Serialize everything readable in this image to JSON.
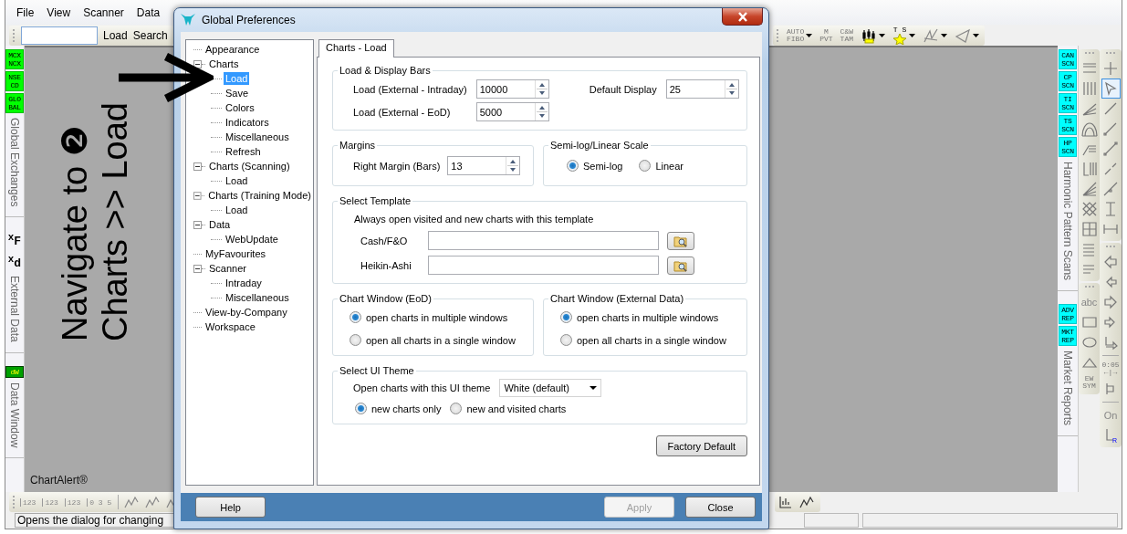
{
  "menu": [
    "File",
    "View",
    "Scanner",
    "Data"
  ],
  "quick_toolbar": {
    "buttons": [
      "Load",
      "Search"
    ]
  },
  "chart_toolbar": [
    {
      "kind": "text",
      "lines": [
        "AUTO",
        "FIBO"
      ],
      "dropdown": true
    },
    {
      "kind": "text",
      "lines": [
        "M",
        "PVT"
      ],
      "dropdown": false
    },
    {
      "kind": "text",
      "lines": [
        "C&W",
        "TAM"
      ],
      "dropdown": false
    },
    {
      "kind": "icon",
      "dropdown": true
    },
    {
      "kind": "star",
      "lines": [
        "T S"
      ],
      "dropdown": true
    },
    {
      "kind": "icon",
      "dropdown": true
    },
    {
      "kind": "icon",
      "dropdown": true
    }
  ],
  "left_tabs": [
    {
      "title": "Global Exchanges",
      "badges": [
        {
          "kind": "exchange",
          "text": "MCX NCX"
        },
        {
          "kind": "exchange",
          "text": "NSE CD"
        },
        {
          "kind": "exchange",
          "text": "GLO BAL"
        }
      ]
    },
    {
      "title": "External Data",
      "badges": [
        {
          "kind": "formula",
          "text": "$^{x}$F"
        },
        {
          "kind": "formula",
          "text": "$^{x}$d"
        }
      ]
    },
    {
      "title": "Data Window",
      "badges": [
        {
          "kind": "data",
          "text": "dW"
        }
      ]
    }
  ],
  "canvas_label": "ChartAlert®",
  "annotation": {
    "lines": [
      "Navigate to ❷",
      "Charts >> Load"
    ]
  },
  "scan_tabs": [
    {
      "title": "Harmonic Pattern Scans",
      "badges": [
        "CAN SCN",
        "CP SCN",
        "TI SCN",
        "TS SCN",
        "HP SCN"
      ]
    },
    {
      "title": "Market Reports",
      "badges": [
        "ADV REP",
        "MKT REP"
      ]
    }
  ],
  "drawing_tools": {
    "column_1": [
      {
        "kind": "grip"
      },
      {
        "kind": "icon",
        "selected": false
      },
      {
        "kind": "icon",
        "selected": false
      },
      {
        "kind": "icon",
        "selected": false
      },
      {
        "kind": "icon",
        "selected": false
      },
      {
        "kind": "icon",
        "selected": false
      },
      {
        "kind": "icon",
        "selected": false
      },
      {
        "kind": "icon",
        "selected": false
      },
      {
        "kind": "icon",
        "selected": false
      },
      {
        "kind": "icon",
        "selected": false
      },
      {
        "kind": "icon",
        "selected": false
      },
      {
        "kind": "icon",
        "selected": false
      },
      {
        "kind": "grip"
      },
      {
        "kind": "text",
        "lines": [
          "abc"
        ],
        "selected": false
      },
      {
        "kind": "icon",
        "selected": false
      },
      {
        "kind": "icon",
        "selected": false
      },
      {
        "kind": "icon",
        "selected": false
      },
      {
        "kind": "text",
        "lines": [
          "EW",
          "SYM"
        ],
        "selected": false
      }
    ],
    "column_2": [
      {
        "kind": "grip"
      },
      {
        "kind": "icon",
        "selected": false
      },
      {
        "kind": "icon",
        "selected": true
      },
      {
        "kind": "icon",
        "selected": false
      },
      {
        "kind": "icon",
        "selected": false
      },
      {
        "kind": "icon",
        "selected": false
      },
      {
        "kind": "icon",
        "selected": false
      },
      {
        "kind": "icon",
        "selected": false
      },
      {
        "kind": "icon",
        "selected": false
      },
      {
        "kind": "icon",
        "selected": false
      },
      {
        "kind": "grip"
      },
      {
        "kind": "icon",
        "selected": false
      },
      {
        "kind": "icon",
        "selected": false
      },
      {
        "kind": "icon",
        "selected": false
      },
      {
        "kind": "icon",
        "selected": false
      },
      {
        "kind": "icon",
        "selected": false
      },
      {
        "kind": "separator"
      },
      {
        "kind": "text",
        "lines": [
          "0:05",
          "←|→"
        ],
        "selected": false
      },
      {
        "kind": "icon",
        "selected": false
      },
      {
        "kind": "separator"
      },
      {
        "kind": "text",
        "lines": [
          "On"
        ],
        "selected": false
      },
      {
        "kind": "icon",
        "text": "R",
        "selected": false
      }
    ]
  },
  "bottom_toolbar": [
    {
      "kind": "text",
      "text": "123"
    },
    {
      "kind": "text",
      "text": "123"
    },
    {
      "kind": "text",
      "text": "123"
    },
    {
      "kind": "text",
      "text": "0 3 5"
    },
    {
      "kind": "separator"
    },
    {
      "kind": "icon"
    },
    {
      "kind": "icon"
    },
    {
      "kind": "icon"
    }
  ],
  "status_bar": {
    "text": "Opens the dialog for changing"
  },
  "dialog": {
    "title": "Global Preferences",
    "tree": [
      {
        "label": "Appearance",
        "selected": false
      },
      {
        "label": "Charts",
        "selected": false,
        "expanded": true,
        "children": [
          {
            "label": "Load",
            "selected": true
          },
          {
            "label": "Save",
            "selected": false
          },
          {
            "label": "Colors",
            "selected": false
          },
          {
            "label": "Indicators",
            "selected": false
          },
          {
            "label": "Miscellaneous",
            "selected": false
          },
          {
            "label": "Refresh",
            "selected": false
          }
        ]
      },
      {
        "label": "Charts (Scanning)",
        "selected": false,
        "expanded": true,
        "children": [
          {
            "label": "Load",
            "selected": false
          }
        ]
      },
      {
        "label": "Charts (Training Mode)",
        "selected": false,
        "expanded": true,
        "children": [
          {
            "label": "Load",
            "selected": false
          }
        ]
      },
      {
        "label": "Data",
        "selected": false,
        "expanded": true,
        "children": [
          {
            "label": "WebUpdate",
            "selected": false
          }
        ]
      },
      {
        "label": "MyFavourites",
        "selected": false
      },
      {
        "label": "Scanner",
        "selected": false,
        "expanded": true,
        "children": [
          {
            "label": "Intraday",
            "selected": false
          },
          {
            "label": "Miscellaneous",
            "selected": false
          }
        ]
      },
      {
        "label": "View-by-Company",
        "selected": false
      },
      {
        "label": "Workspace",
        "selected": false
      }
    ],
    "tabs": [
      {
        "label": "Charts - Load",
        "selected": true
      }
    ],
    "load_display_bars": {
      "title": "Load & Display Bars",
      "fields": [
        {
          "label": "Load (External - Intraday)",
          "value": "10000"
        },
        {
          "label": "Load (External - EoD)",
          "value": "5000"
        },
        {
          "label": "Default Display",
          "value": "25"
        }
      ]
    },
    "margins": {
      "title": "Margins",
      "field": {
        "label": "Right Margin (Bars)",
        "value": "13"
      }
    },
    "scale": {
      "title": "Semi-log/Linear Scale",
      "options": [
        {
          "label": "Semi-log",
          "selected": true
        },
        {
          "label": "Linear",
          "selected": false
        }
      ]
    },
    "template": {
      "title": "Select Template",
      "note": "Always open visited and new charts with this template",
      "fields": [
        {
          "label": "Cash/F&O"
        },
        {
          "label": "Heikin-Ashi"
        }
      ]
    },
    "chart_windows": [
      {
        "title": "Chart Window (EoD)",
        "options": [
          {
            "label": "open charts in multiple windows",
            "selected": true
          },
          {
            "label": "open all charts in a single window",
            "selected": false
          }
        ]
      },
      {
        "title": "Chart Window (External Data)",
        "options": [
          {
            "label": "open charts in multiple windows",
            "selected": true
          },
          {
            "label": "open all charts in a single window",
            "selected": false
          }
        ]
      }
    ],
    "ui_theme": {
      "title": "Select UI Theme",
      "label": "Open charts with this UI theme",
      "value": "White (default)",
      "options": [
        {
          "label": "new charts only",
          "selected": true
        },
        {
          "label": "new and visited charts",
          "selected": false
        }
      ]
    },
    "factory_default": "Factory Default",
    "buttons": [
      {
        "label": "Help",
        "disabled": false
      },
      {
        "label": "Apply",
        "disabled": true
      },
      {
        "label": "Close",
        "disabled": false
      }
    ]
  }
}
